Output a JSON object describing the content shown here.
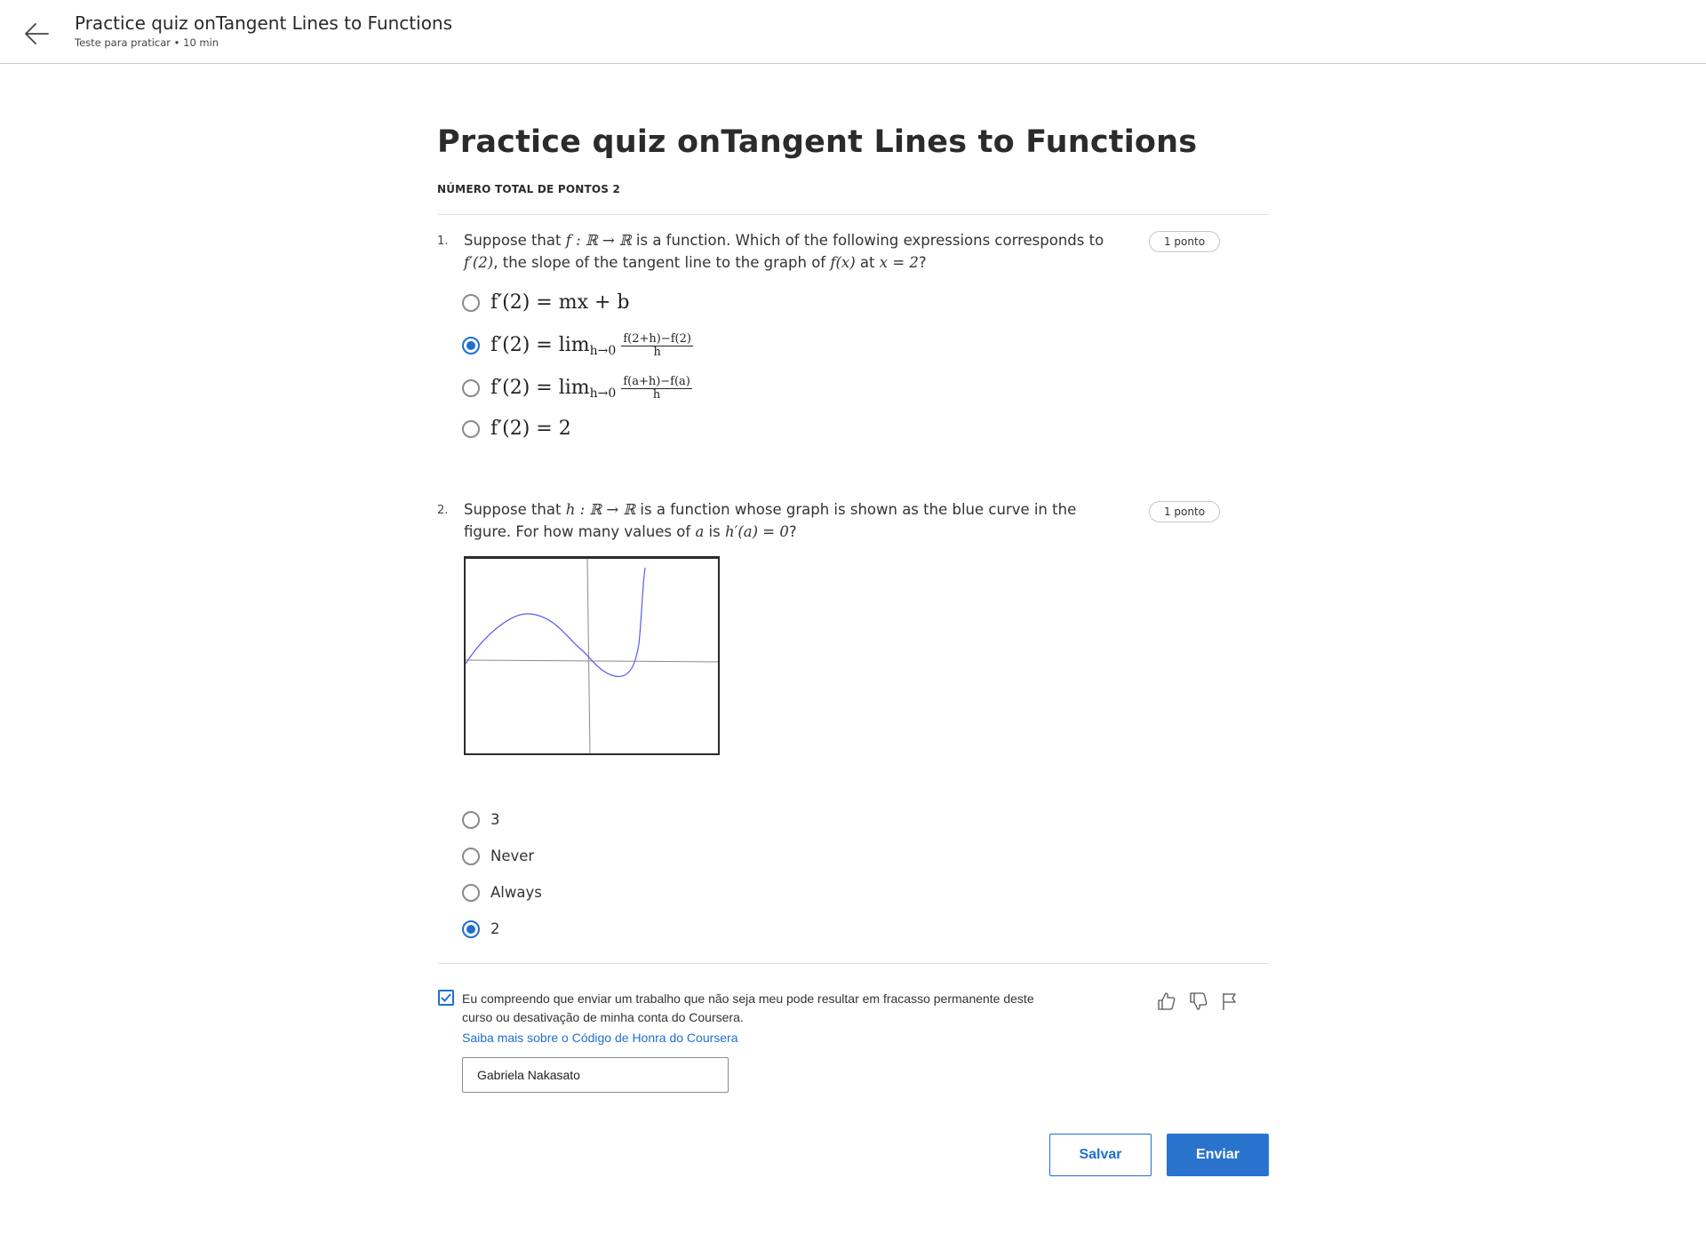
{
  "header": {
    "title": "Practice quiz onTangent Lines to Functions",
    "subtitle": "Teste para praticar • 10 min",
    "back_icon": "arrow-left-icon"
  },
  "main": {
    "title": "Practice quiz onTangent Lines to Functions",
    "total_points": "NÚMERO TOTAL DE PONTOS 2"
  },
  "questions": [
    {
      "number": "1.",
      "points": "1 ponto",
      "text_parts": [
        "Suppose that",
        "is a function. Which of the following expressions corresponds to",
        ",",
        "the slope of the tangent line to the graph of",
        "at",
        "?"
      ],
      "math": [
        "f : ℝ → ℝ",
        "f′(2)",
        "f(x)",
        "x = 2"
      ],
      "options": [
        {
          "label": "f′(2) = mx + b",
          "selected": false
        },
        {
          "label": "f′(2) = lim",
          "sub": "h→0",
          "num": "f(2+h)−f(2)",
          "den": "h",
          "selected": true
        },
        {
          "label": "f′(2) = lim",
          "sub": "h→0",
          "num": "f(a+h)−f(a)",
          "den": "h",
          "selected": false
        },
        {
          "label": "f′(2) = 2",
          "selected": false
        }
      ]
    },
    {
      "number": "2.",
      "points": "1 ponto",
      "text_parts": [
        "Suppose that",
        "is a function whose graph is shown as the blue curve in the figure. For",
        "how many values of",
        "is",
        "?"
      ],
      "math": [
        "h : ℝ → ℝ",
        "a",
        "h′(a) = 0"
      ],
      "options": [
        {
          "label": "3",
          "selected": false
        },
        {
          "label": "Never",
          "selected": false
        },
        {
          "label": "Always",
          "selected": false
        },
        {
          "label": "2",
          "selected": true
        }
      ]
    }
  ],
  "honor": {
    "checked": true,
    "text": "Eu compreendo que enviar um trabalho que não seja meu pode resultar em fracasso permanente deste curso ou desativação de minha conta do Coursera.",
    "link": "Saiba mais sobre o Código de Honra do Coursera",
    "name_value": "Gabriela Nakasato"
  },
  "feedback_icons": [
    "thumbs-up-icon",
    "thumbs-down-icon",
    "flag-icon"
  ],
  "buttons": {
    "save": "Salvar",
    "submit": "Enviar"
  },
  "colors": {
    "accent": "#1f6fd0",
    "submit_bg": "#2a73cc",
    "curve": "#5b5bf0"
  }
}
